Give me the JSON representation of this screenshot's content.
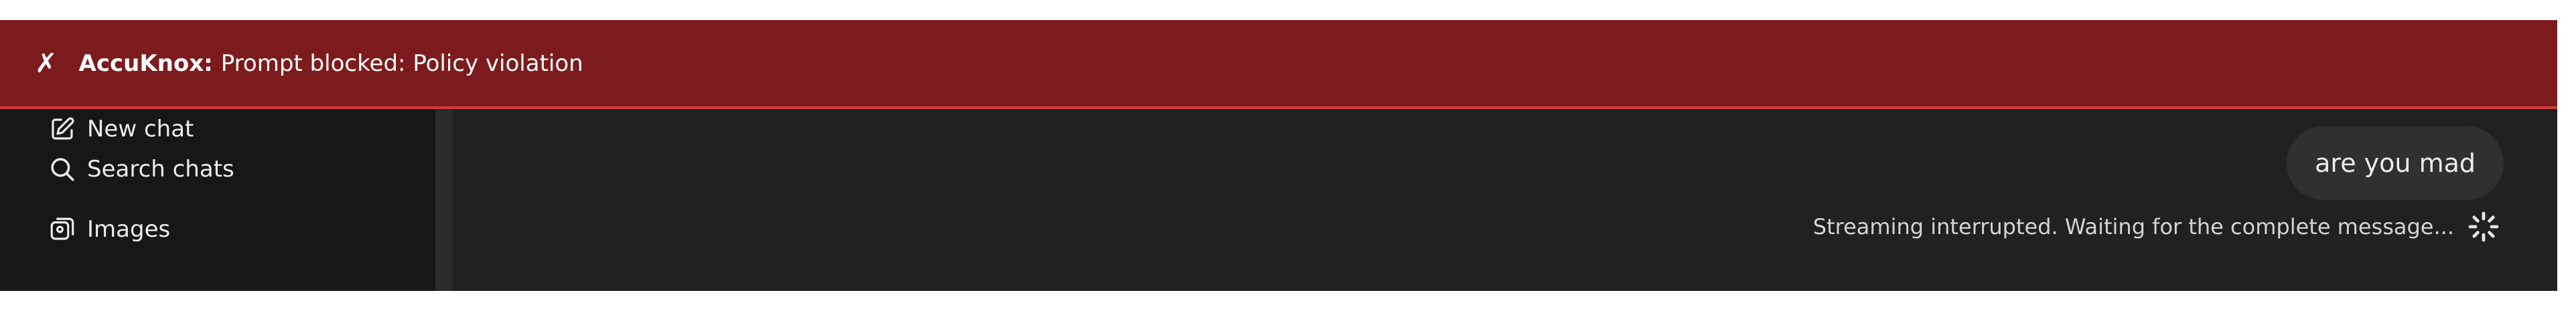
{
  "banner": {
    "close_glyph": "✗",
    "brand": "AccuKnox:",
    "message": "Prompt blocked: Policy violation",
    "color": "#7c1b1d"
  },
  "sidebar": {
    "items": [
      {
        "icon": "edit-icon",
        "label": "New chat"
      },
      {
        "icon": "search-icon",
        "label": "Search chats"
      },
      {
        "icon": "images-icon",
        "label": "Images"
      }
    ]
  },
  "chat": {
    "user_message": "are you mad",
    "status": "Streaming interrupted. Waiting for the complete message..."
  }
}
